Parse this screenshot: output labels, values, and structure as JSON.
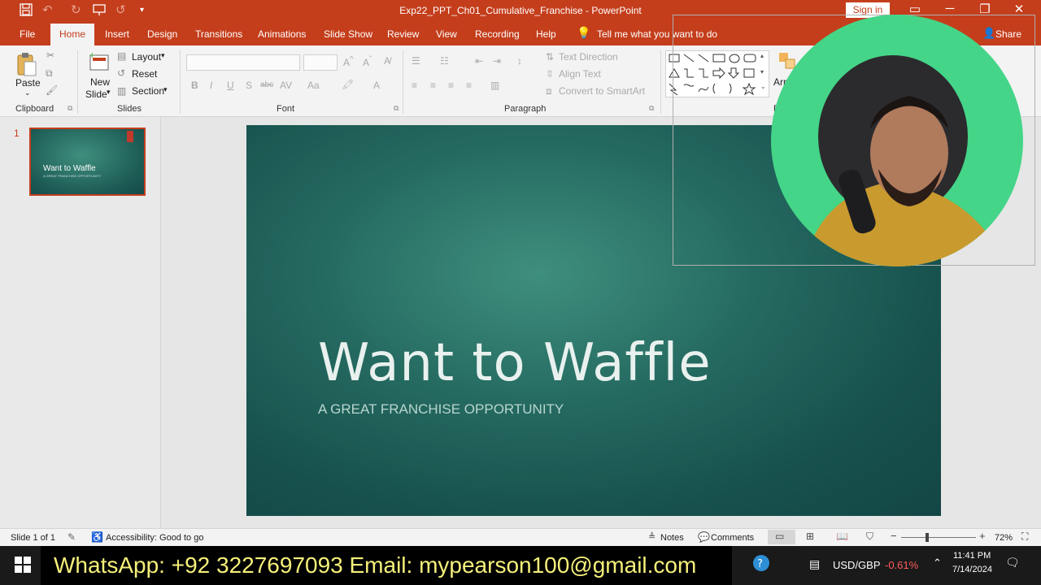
{
  "window": {
    "title": "Exp22_PPT_Ch01_Cumulative_Franchise  -  PowerPoint",
    "sign_in": "Sign in"
  },
  "tabs": [
    "File",
    "Home",
    "Insert",
    "Design",
    "Transitions",
    "Animations",
    "Slide Show",
    "Review",
    "View",
    "Recording",
    "Help"
  ],
  "tell_me": "Tell me what you want to do",
  "share": "Share",
  "ribbon": {
    "clipboard": {
      "paste": "Paste",
      "label": "Clipboard"
    },
    "slides": {
      "new_slide": "New",
      "new_slide2": "Slide",
      "layout": "Layout",
      "reset": "Reset",
      "section": "Section",
      "label": "Slides"
    },
    "font": {
      "label": "Font"
    },
    "paragraph": {
      "text_direction": "Text Direction",
      "align_text": "Align Text",
      "convert_smartart": "Convert to SmartArt",
      "label": "Paragraph"
    },
    "drawing": {
      "arrange": "Arr"
    }
  },
  "slide_panel": {
    "number": "1",
    "thumb_title": "Want to Waffle",
    "thumb_sub": "A GREAT FRANCHISE OPPORTUNITY"
  },
  "slide": {
    "title": "Want to Waffle",
    "subtitle": "A GREAT FRANCHISE OPPORTUNITY"
  },
  "status": {
    "slide_of": "Slide 1 of 1",
    "accessibility": "Accessibility: Good to go",
    "notes": "Notes",
    "comments": "Comments",
    "zoom": "72%"
  },
  "taskbar": {
    "banner": "WhatsApp: +92 3227697093  Email: mypearson100@gmail.com",
    "currency": "USD/GBP",
    "change": "-0.61%",
    "time": "11:41 PM",
    "date": "7/14/2024"
  },
  "colors": {
    "accent": "#c43e1c",
    "slide_bg": "#1f615a",
    "banner_text": "#f5f07a",
    "change_red": "#ff5b5b"
  }
}
